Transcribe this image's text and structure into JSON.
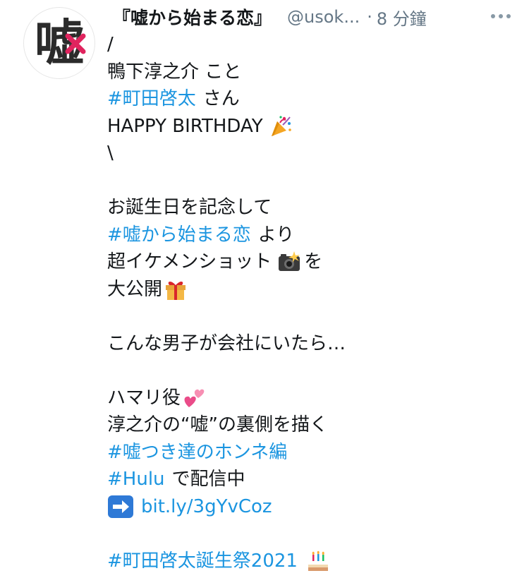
{
  "tweet": {
    "avatar_char": "嘘",
    "display_name": "『嘘から始まる恋』",
    "handle": "@usok...",
    "separator": "·",
    "time": "8 分鐘"
  },
  "lines": {
    "l1": "/",
    "l2": "鴨下淳之介 こと",
    "l3_tag": "#町田啓太",
    "l3_rest": "さん",
    "l4": "HAPPY BIRTHDAY",
    "l5": "\\",
    "l7": "お誕生日を記念して",
    "l8_tag": "#嘘から始まる恋",
    "l8_rest": "より",
    "l9a": "超イケメンショット",
    "l9b": "を",
    "l10": "大公開",
    "l12": "こんな男子が会社にいたら…",
    "l14": "ハマリ役",
    "l15": "淳之介の“嘘”の裏側を描く",
    "l16_tag": "#嘘つき達のホンネ編",
    "l17_tag": "#Hulu",
    "l17_rest": "で配信中",
    "l18_link": "bit.ly/3gYvCoz",
    "l20_tag": "#町田啓太誕生祭2021"
  },
  "icons": {
    "more": "more-dots-icon",
    "party": "party-popper-icon",
    "camera": "camera-flash-icon",
    "gift": "gift-icon",
    "hearts": "two-hearts-icon",
    "arrow": "right-arrow-icon",
    "cake": "birthday-cake-icon"
  },
  "colors": {
    "link": "#1b95e0",
    "text": "#14171a",
    "muted": "#657786",
    "cross": "#e0245e"
  }
}
